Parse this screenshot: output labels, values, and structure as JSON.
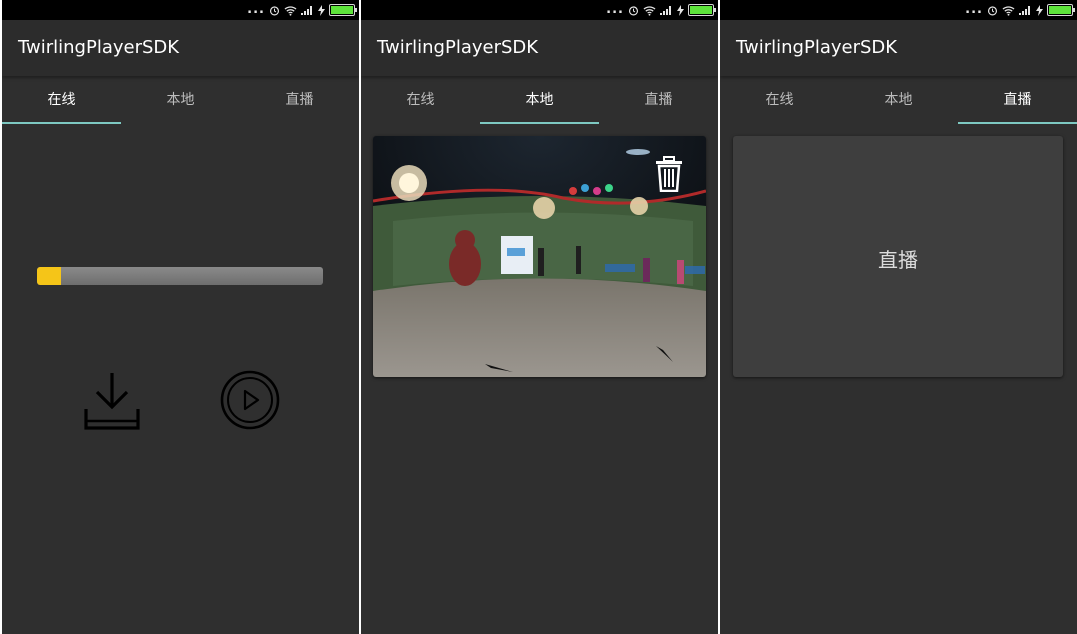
{
  "app": {
    "title": "TwirlingPlayerSDK"
  },
  "tabs": [
    {
      "label": "在线"
    },
    {
      "label": "本地"
    },
    {
      "label": "直播"
    }
  ],
  "online": {
    "download_progress": 0.085,
    "download_icon": "download-icon",
    "play_icon": "play-circle-icon"
  },
  "local": {
    "video_thumbnail": "panorama-video-thumbnail",
    "delete_icon": "trash-icon"
  },
  "live": {
    "card_label": "直播"
  },
  "status_bar": {
    "dots": "...",
    "icons": [
      "alarm-icon",
      "wifi-icon",
      "signal-icon",
      "charging-icon",
      "battery-icon"
    ]
  },
  "colors": {
    "background": "#2f2f2f",
    "tab_indicator": "#7ec9c2",
    "progress_fill": "#f5c518",
    "battery": "#5ee43b"
  }
}
